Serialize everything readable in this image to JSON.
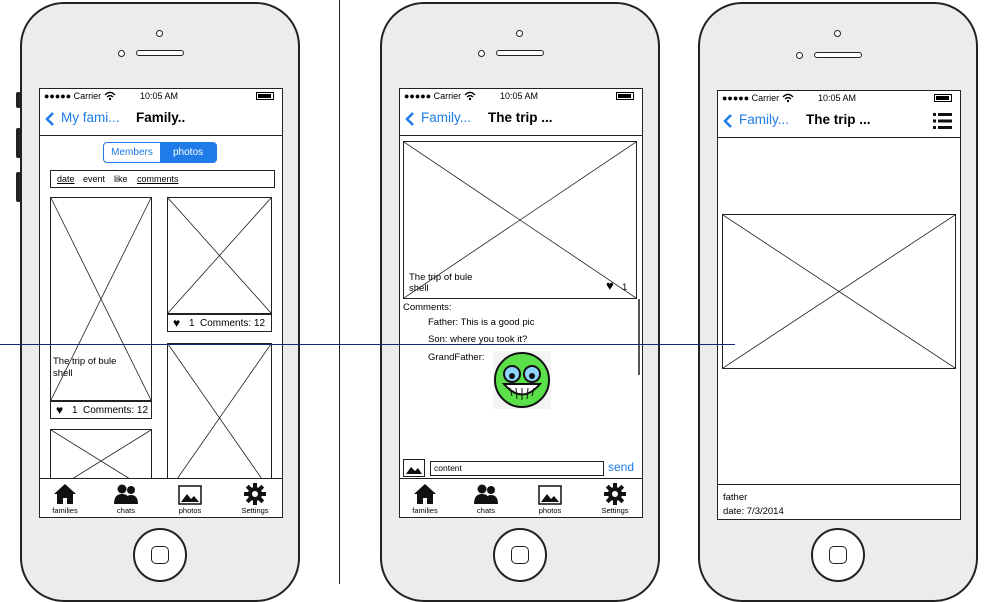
{
  "status": {
    "carrier": "●●●●● Carrier",
    "time": "10:05 AM"
  },
  "tabs": [
    {
      "label": "families",
      "icon": "home-icon"
    },
    {
      "label": "chats",
      "icon": "people-icon"
    },
    {
      "label": "photos",
      "icon": "photo-icon"
    },
    {
      "label": "Settings",
      "icon": "gear-icon"
    }
  ],
  "screen1": {
    "back_label": "My fami...",
    "title": "Family..",
    "segments": [
      "Members",
      "photos"
    ],
    "selected_segment": "photos",
    "sort_options": [
      "date",
      "event",
      "like",
      "comments"
    ],
    "photo1_caption": "The trip of bule shell",
    "photo1_likes": "1",
    "photo1_comments": "Comments: 12",
    "photo2_likes": "1",
    "photo2_comments": "Comments: 12"
  },
  "screen2": {
    "back_label": "Family...",
    "title": "The trip ...",
    "photo_caption": "The trip of bule shell",
    "likes": "1",
    "comments_header": "Comments:",
    "comments": [
      {
        "text": "Father: This is a good pic"
      },
      {
        "text": "Son: where you took it?"
      },
      {
        "text": "GrandFather:"
      }
    ],
    "input_value": "content",
    "send_label": "send"
  },
  "screen3": {
    "back_label": "Family...",
    "title": "The trip ...",
    "author": "father",
    "date": "date: 7/3/2014"
  },
  "colors": {
    "accent": "#1e7be8",
    "phone_body": "#ececec",
    "divider_line": "#1a237e"
  }
}
